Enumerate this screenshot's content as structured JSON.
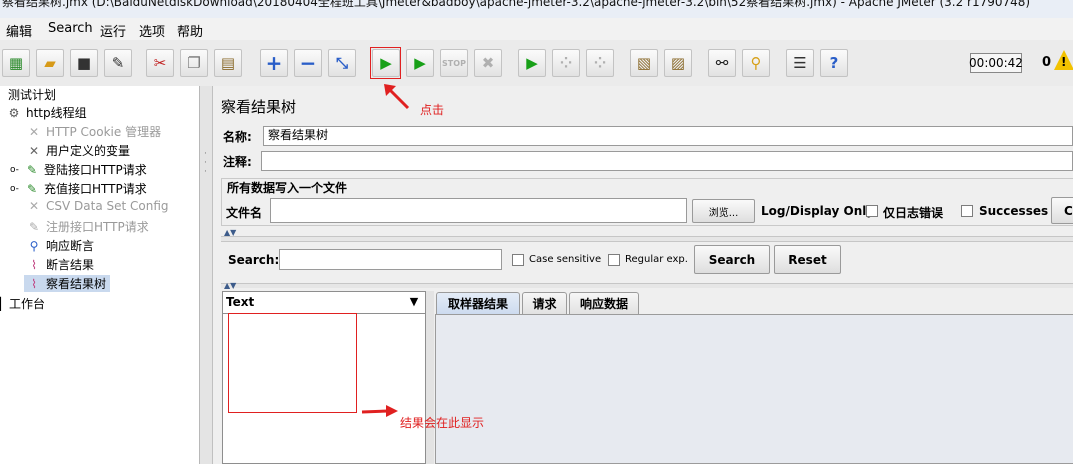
{
  "window": {
    "title": "察看结果树.jmx (D:\\BaiduNetdiskDownload\\20180404全程班工具\\Jmeter&badboy\\apache-jmeter-3.2\\apache-jmeter-3.2\\bin\\52察看结果树.jmx) - Apache JMeter (3.2 r1790748)"
  },
  "menu": [
    "编辑",
    "Search",
    "运行",
    "选项",
    "帮助"
  ],
  "toolbar": {
    "timer": "00:00:42",
    "error_count": "0",
    "warn_mark": "!"
  },
  "tree": [
    {
      "label": "测试计划",
      "icon": "test-plan"
    },
    {
      "label": "http线程组",
      "icon": "gear"
    },
    {
      "label": "HTTP Cookie 管理器",
      "icon": "cookie-tools"
    },
    {
      "label": "用户定义的变量",
      "icon": "tools"
    },
    {
      "label": "登陆接口HTTP请求",
      "icon": "pencil"
    },
    {
      "label": "充值接口HTTP请求",
      "icon": "pencil"
    },
    {
      "label": "CSV Data Set Config",
      "icon": "tools"
    },
    {
      "label": "注册接口HTTP请求",
      "icon": "pencil"
    },
    {
      "label": "响应断言",
      "icon": "magnifier"
    },
    {
      "label": "断言结果",
      "icon": "chart"
    },
    {
      "label": "察看结果树",
      "icon": "chart"
    },
    {
      "label": "工作台",
      "icon": "workbench"
    }
  ],
  "panel": {
    "title": "察看结果树",
    "name_label": "名称:",
    "name_value": "察看结果树",
    "comment_label": "注释:",
    "comment_value": "",
    "group_title": "所有数据写入一个文件",
    "file_label": "文件名",
    "file_value": "",
    "browse_label": "浏览...",
    "log_display_label": "Log/Display Only:",
    "errors_only_label": "仅日志错误",
    "successes_label": "Successes",
    "config_button_partial": "C"
  },
  "search": {
    "label": "Search:",
    "value": "",
    "case_sensitive_label": "Case sensitive",
    "regex_label": "Regular exp.",
    "search_button": "Search",
    "reset_button": "Reset"
  },
  "results": {
    "renderer_selected": "Text",
    "tabs": [
      "取样器结果",
      "请求",
      "响应数据"
    ]
  },
  "annotations": {
    "click_note": "点击",
    "results_note": "结果会在此显示"
  },
  "colors": {
    "annotation_red": "#e02020",
    "start_green": "#18a018",
    "selection_blue": "#c9d9ee"
  }
}
